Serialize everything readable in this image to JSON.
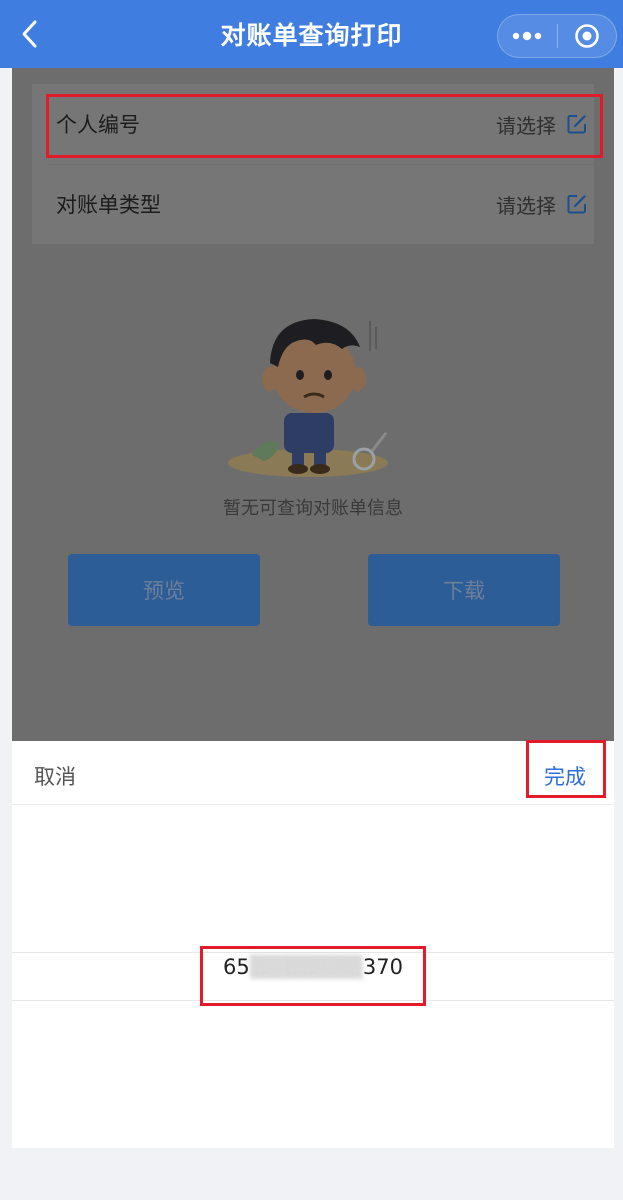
{
  "header": {
    "title": "对账单查询打印",
    "back_icon": "chevron-left-icon",
    "more_icon": "more-dots-icon",
    "close_icon": "target-circle-icon",
    "color": "#3f7de0"
  },
  "form": {
    "rows": [
      {
        "label": "个人编号",
        "value": "请选择",
        "icon": "edit-icon"
      },
      {
        "label": "对账单类型",
        "value": "请选择",
        "icon": "edit-icon"
      }
    ]
  },
  "empty_state": {
    "illustration": "sad-boy-illustration",
    "text": "暂无可查询对账单信息"
  },
  "actions": {
    "preview_label": "预览",
    "download_label": "下载"
  },
  "picker": {
    "cancel_label": "取消",
    "done_label": "完成",
    "selected_prefix": "65",
    "selected_masked": "▒▒▒▒▒▒▒",
    "selected_suffix": "370",
    "accent": "#2f6fd9"
  },
  "highlight_color": "#e21b2b"
}
